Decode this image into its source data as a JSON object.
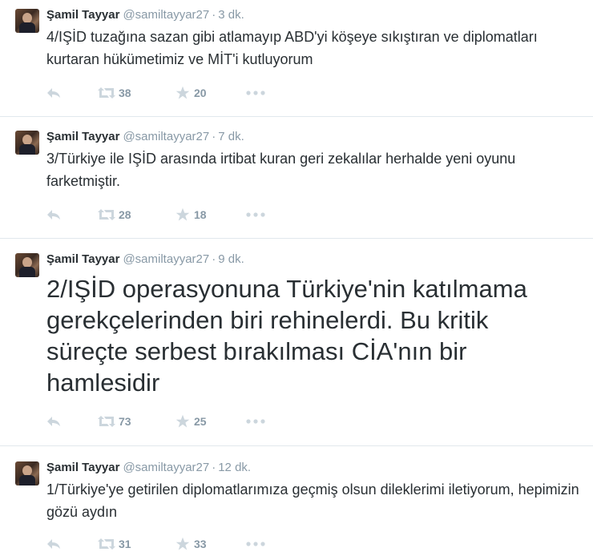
{
  "tweets": [
    {
      "name": "Şamil Tayyar",
      "handle": "@samiltayyar27",
      "separator": "·",
      "time": "3 dk.",
      "text": "4/IŞİD tuzağına sazan gibi atlamayıp ABD'yi köşeye sıkıştıran ve diplomatları kurtaran hükümetimiz ve MİT'i kutluyorum",
      "retweets": "38",
      "favorites": "20"
    },
    {
      "name": "Şamil Tayyar",
      "handle": "@samiltayyar27",
      "separator": "·",
      "time": "7 dk.",
      "text": "3/Türkiye ile IŞİD arasında irtibat kuran geri zekalılar herhalde yeni oyunu farketmiştir.",
      "retweets": "28",
      "favorites": "18"
    },
    {
      "name": "Şamil Tayyar",
      "handle": "@samiltayyar27",
      "separator": "·",
      "time": "9 dk.",
      "text": "2/IŞİD operasyonuna Türkiye'nin katılmama gerekçelerinden biri rehinelerdi. Bu kritik süreçte serbest bırakılması CİA'nın bir hamlesidir",
      "retweets": "73",
      "favorites": "25"
    },
    {
      "name": "Şamil Tayyar",
      "handle": "@samiltayyar27",
      "separator": "·",
      "time": "12 dk.",
      "text": "1/Türkiye'ye getirilen diplomatlarımıza geçmiş olsun dileklerimi iletiyorum, hepimizin gözü aydın",
      "retweets": "31",
      "favorites": "33"
    }
  ],
  "icons": {
    "reply": "reply-arrow-icon",
    "retweet": "retweet-icon",
    "favorite": "star-icon",
    "more": "more-dots-icon"
  },
  "colors": {
    "text": "#292f33",
    "muted": "#8899a6",
    "divider": "#e1e8ed"
  }
}
